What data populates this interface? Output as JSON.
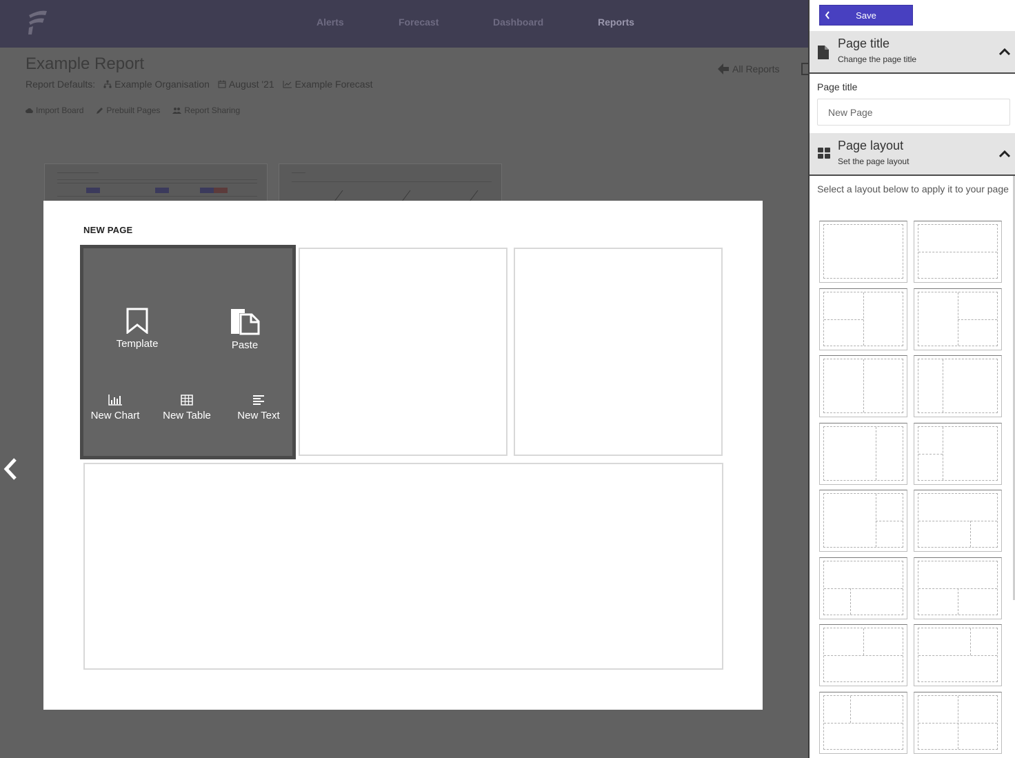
{
  "nav": {
    "links": [
      "Alerts",
      "Forecast",
      "Dashboard",
      "Reports"
    ],
    "active": "Reports"
  },
  "report": {
    "title": "Example Report",
    "defaults_label": "Report Defaults:",
    "organisation": "Example Organisation",
    "date": "August '21",
    "forecast": "Example Forecast",
    "import_board": "Import Board",
    "prebuilt_pages": "Prebuilt Pages",
    "report_sharing": "Report Sharing",
    "all_reports": "All Reports"
  },
  "modal": {
    "title": "NEW PAGE",
    "actions": {
      "template": "Template",
      "paste": "Paste",
      "new_chart": "New Chart",
      "new_table": "New Table",
      "new_text": "New Text"
    }
  },
  "sidebar": {
    "save_label": "Save",
    "page_title_section": {
      "title": "Page title",
      "subtitle": "Change the page title",
      "field_label": "Page title",
      "field_placeholder": "New Page"
    },
    "page_layout_section": {
      "title": "Page layout",
      "subtitle": "Set the page layout",
      "help_text": "Select a layout below to apply it to your page"
    }
  },
  "colors": {
    "save_button": "#4840c0",
    "topnav": "#3f3d52",
    "overlay": "#616161"
  }
}
